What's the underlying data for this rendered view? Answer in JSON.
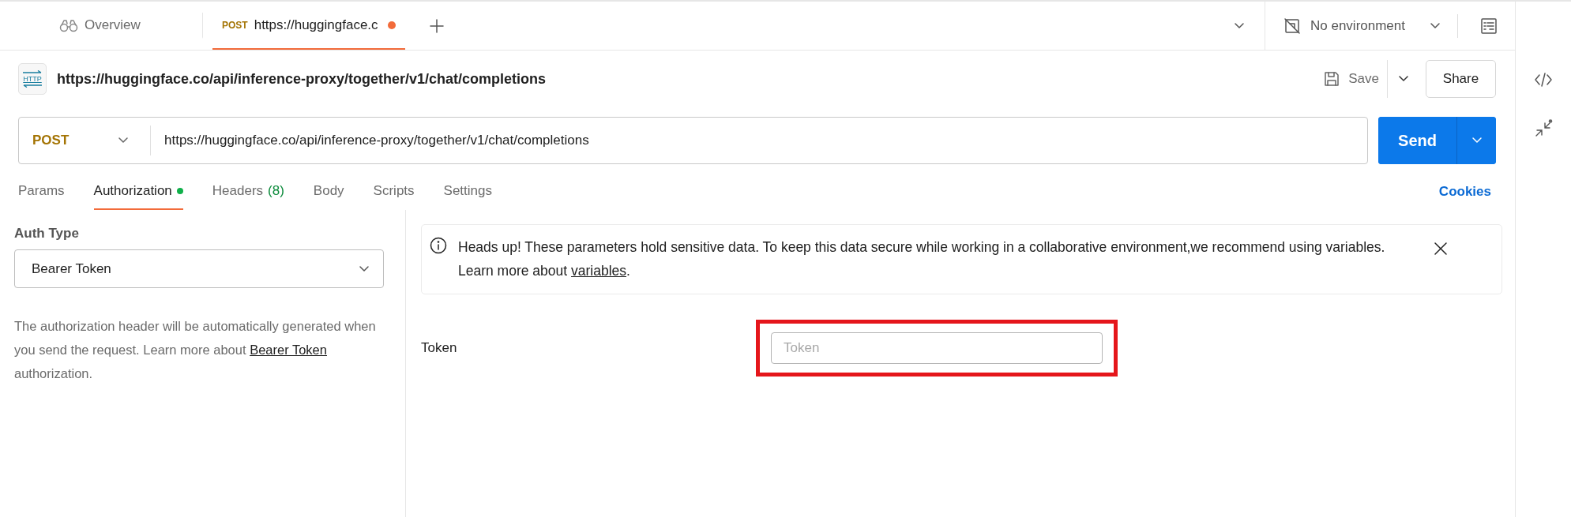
{
  "tabs": [
    {
      "kind": "overview",
      "label": "Overview",
      "selected": false
    },
    {
      "kind": "request",
      "method": "POST",
      "label": "https://huggingface.c",
      "unsaved": true,
      "selected": true
    }
  ],
  "environment": {
    "label": "No environment"
  },
  "request": {
    "icon_label": "HTTP",
    "title": "https://huggingface.co/api/inference-proxy/together/v1/chat/completions",
    "save_label": "Save",
    "share_label": "Share",
    "method": "POST",
    "url": "https://huggingface.co/api/inference-proxy/together/v1/chat/completions",
    "send_label": "Send"
  },
  "request_tabs": [
    {
      "label": "Params",
      "selected": false
    },
    {
      "label": "Authorization",
      "selected": true,
      "status_dot": true
    },
    {
      "label": "Headers",
      "count": "(8)",
      "selected": false
    },
    {
      "label": "Body",
      "selected": false
    },
    {
      "label": "Scripts",
      "selected": false
    },
    {
      "label": "Settings",
      "selected": false
    }
  ],
  "cookies_link": "Cookies",
  "auth": {
    "type_label": "Auth Type",
    "type_value": "Bearer Token",
    "description": "The authorization header will be automatically generated when you send the request. Learn more about ",
    "link": "Bearer Token",
    "description_end": " authorization."
  },
  "notice": {
    "text": "Heads up! These parameters hold sensitive data. To keep this data secure while working in a collaborative environment,we recommend using variables. Learn more about ",
    "link": "variables",
    "text_end": "."
  },
  "token": {
    "label": "Token",
    "placeholder": "Token",
    "highlighted": true
  }
}
